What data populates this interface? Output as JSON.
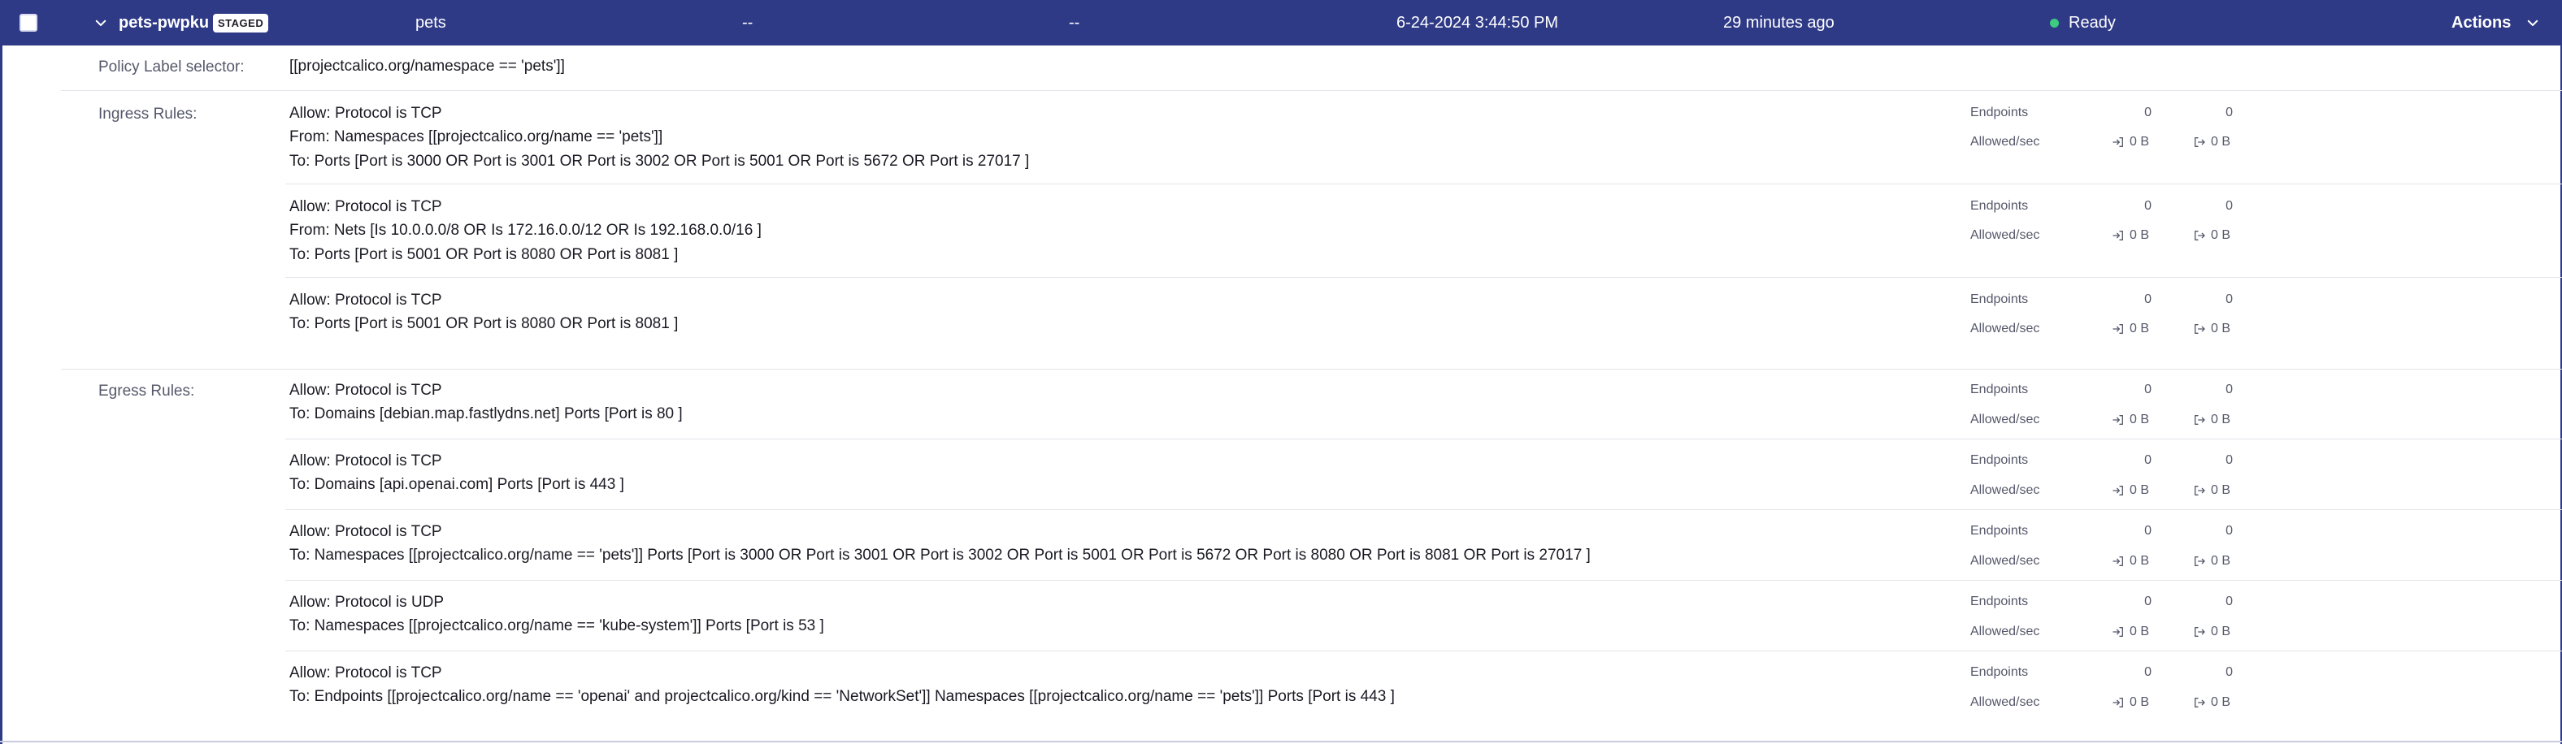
{
  "header": {
    "policy_name": "pets-pwpku",
    "badge": "STAGED",
    "namespace": "pets",
    "col3": "--",
    "col4": "--",
    "created": "6-24-2024 3:44:50 PM",
    "age": "29 minutes ago",
    "status": "Ready",
    "status_color": "#3ccb7f",
    "actions": "Actions",
    "bg_color": "#2f3a87"
  },
  "selector": {
    "label": "Policy Label selector:",
    "value": "[[projectcalico.org/namespace == 'pets']]"
  },
  "ingress": {
    "label": "Ingress Rules:",
    "rules": [
      {
        "lines": [
          "Allow: Protocol is TCP",
          "From: Namespaces [[projectcalico.org/name == 'pets']]",
          "To: Ports [Port is 3000 OR Port is 3001 OR Port is 3002 OR Port is 5001 OR Port is 5672 OR Port is 27017 ]"
        ],
        "endpoints_label": "Endpoints",
        "endpoints_in": "0",
        "endpoints_out": "0",
        "allowed_label": "Allowed/sec",
        "allowed_in": "0 B",
        "allowed_out": "0 B"
      },
      {
        "lines": [
          "Allow: Protocol is TCP",
          "From: Nets [Is 10.0.0.0/8 OR Is 172.16.0.0/12 OR Is 192.168.0.0/16 ]",
          "To: Ports [Port is 5001 OR Port is 8080 OR Port is 8081 ]"
        ],
        "endpoints_label": "Endpoints",
        "endpoints_in": "0",
        "endpoints_out": "0",
        "allowed_label": "Allowed/sec",
        "allowed_in": "0 B",
        "allowed_out": "0 B"
      },
      {
        "lines": [
          "Allow: Protocol is TCP",
          "To: Ports [Port is 5001 OR Port is 8080 OR Port is 8081 ]"
        ],
        "endpoints_label": "Endpoints",
        "endpoints_in": "0",
        "endpoints_out": "0",
        "allowed_label": "Allowed/sec",
        "allowed_in": "0 B",
        "allowed_out": "0 B"
      }
    ]
  },
  "egress": {
    "label": "Egress Rules:",
    "rules": [
      {
        "lines": [
          "Allow: Protocol is TCP",
          "To: Domains [debian.map.fastlydns.net]  Ports [Port is 80 ]"
        ],
        "endpoints_label": "Endpoints",
        "endpoints_in": "0",
        "endpoints_out": "0",
        "allowed_label": "Allowed/sec",
        "allowed_in": "0 B",
        "allowed_out": "0 B"
      },
      {
        "lines": [
          "Allow: Protocol is TCP",
          "To: Domains [api.openai.com]  Ports [Port is 443 ]"
        ],
        "endpoints_label": "Endpoints",
        "endpoints_in": "0",
        "endpoints_out": "0",
        "allowed_label": "Allowed/sec",
        "allowed_in": "0 B",
        "allowed_out": "0 B"
      },
      {
        "lines": [
          "Allow: Protocol is TCP",
          "To: Namespaces [[projectcalico.org/name == 'pets']] Ports [Port is 3000 OR Port is 3001 OR Port is 3002 OR Port is 5001 OR Port is 5672 OR Port is 8080 OR Port is 8081 OR Port is 27017 ]"
        ],
        "endpoints_label": "Endpoints",
        "endpoints_in": "0",
        "endpoints_out": "0",
        "allowed_label": "Allowed/sec",
        "allowed_in": "0 B",
        "allowed_out": "0 B"
      },
      {
        "lines": [
          "Allow: Protocol is UDP",
          "To: Namespaces [[projectcalico.org/name == 'kube-system']] Ports [Port is 53 ]"
        ],
        "endpoints_label": "Endpoints",
        "endpoints_in": "0",
        "endpoints_out": "0",
        "allowed_label": "Allowed/sec",
        "allowed_in": "0 B",
        "allowed_out": "0 B"
      },
      {
        "lines": [
          "Allow: Protocol is TCP",
          "To: Endpoints [[projectcalico.org/name == 'openai' and projectcalico.org/kind == 'NetworkSet']] Namespaces [[projectcalico.org/name == 'pets']] Ports [Port is 443 ]"
        ],
        "endpoints_label": "Endpoints",
        "endpoints_in": "0",
        "endpoints_out": "0",
        "allowed_label": "Allowed/sec",
        "allowed_in": "0 B",
        "allowed_out": "0 B"
      }
    ]
  }
}
